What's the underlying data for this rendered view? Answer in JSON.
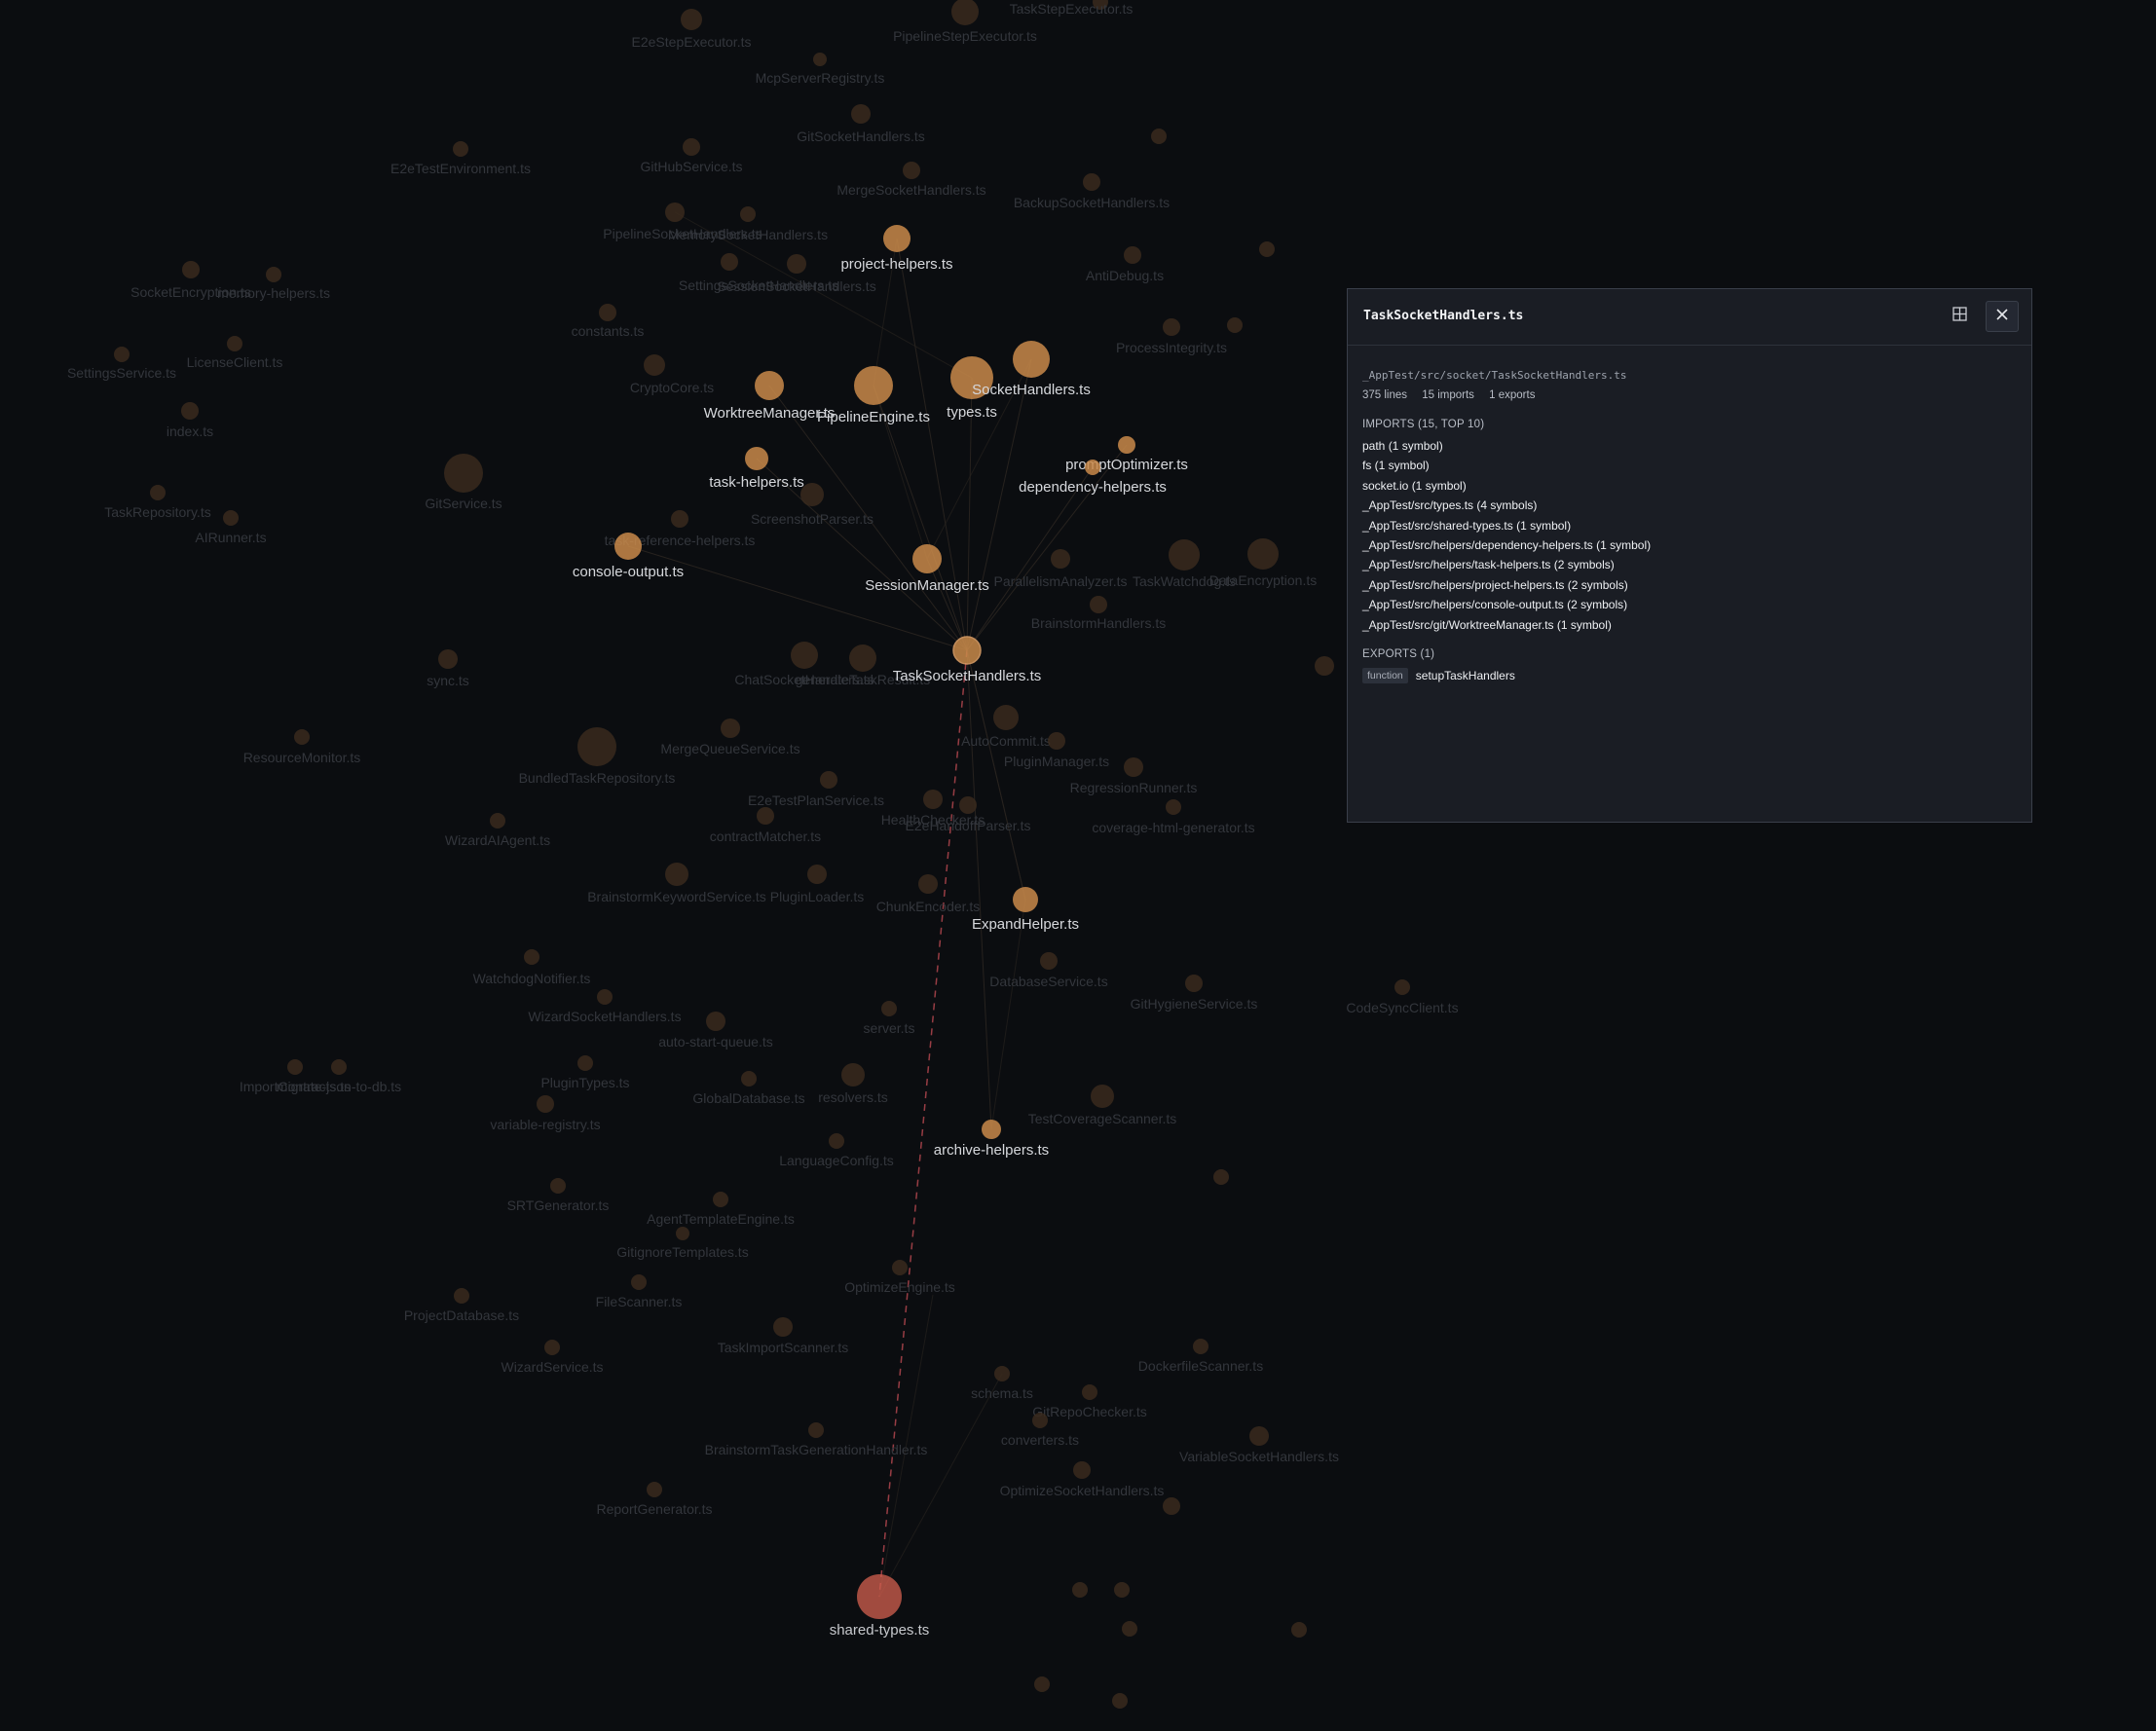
{
  "panel": {
    "title": "TaskSocketHandlers.ts",
    "path": "_AppTest/src/socket/TaskSocketHandlers.ts",
    "lines": "375 lines",
    "imports_count": "15 imports",
    "exports_count": "1 exports",
    "imports_heading": "IMPORTS (15, TOP 10)",
    "imports": [
      "path (1 symbol)",
      "fs (1 symbol)",
      "socket.io (1 symbol)",
      "_AppTest/src/types.ts (4 symbols)",
      "_AppTest/src/shared-types.ts (1 symbol)",
      "_AppTest/src/helpers/dependency-helpers.ts (1 symbol)",
      "_AppTest/src/helpers/task-helpers.ts (2 symbols)",
      "_AppTest/src/helpers/project-helpers.ts (2 symbols)",
      "_AppTest/src/helpers/console-output.ts (2 symbols)",
      "_AppTest/src/git/WorktreeManager.ts (1 symbol)"
    ],
    "exports_heading": "EXPORTS (1)",
    "exports": [
      {
        "kind": "function",
        "name": "setupTaskHandlers"
      }
    ],
    "expand_icon": "grid-expand-icon",
    "close_icon": "close-icon"
  },
  "colors": {
    "background": "#0b0d10",
    "active_node": "#c98a4a",
    "selected_node": "#d4604f",
    "dim_node": "#3a2a1d",
    "label_active": "#d6d8dc",
    "label_dim": "#33363c",
    "edge_dashed": "#a8434a"
  },
  "graph": {
    "active_nodes": [
      {
        "id": "TaskSocketHandlers.ts",
        "label": "TaskSocketHandlers.ts"
      },
      {
        "id": "project-helpers.ts",
        "label": "project-helpers.ts"
      },
      {
        "id": "WorktreeManager.ts",
        "label": "WorktreeManager.ts"
      },
      {
        "id": "PipelineEngine.ts",
        "label": "PipelineEngine.ts"
      },
      {
        "id": "types.ts",
        "label": "types.ts"
      },
      {
        "id": "SocketHandlers.ts",
        "label": "SocketHandlers.ts"
      },
      {
        "id": "promptOptimizer.ts",
        "label": "promptOptimizer.ts"
      },
      {
        "id": "dependency-helpers.ts",
        "label": "dependency-helpers.ts"
      },
      {
        "id": "task-helpers.ts",
        "label": "task-helpers.ts"
      },
      {
        "id": "console-output.ts",
        "label": "console-output.ts"
      },
      {
        "id": "SessionManager.ts",
        "label": "SessionManager.ts"
      },
      {
        "id": "ExpandHelper.ts",
        "label": "ExpandHelper.ts"
      },
      {
        "id": "archive-helpers.ts",
        "label": "archive-helpers.ts"
      },
      {
        "id": "shared-types.ts",
        "label": "shared-types.ts"
      }
    ],
    "dim_nodes": [
      "E2eStepExecutor.ts",
      "PipelineStepExecutor.ts",
      "TaskStepExecutor.ts",
      "McpServerRegistry.ts",
      "GitSocketHandlers.ts",
      "E2eTestEnvironment.ts",
      "GitHubService.ts",
      "MergeSocketHandlers.ts",
      "BackupSocketHandlers.ts",
      "PipelineSocketHandlers.ts",
      "MemorySocketHandlers.ts",
      "SettingsSocketHandlers.ts",
      "SessionSocketHandlers.ts",
      "AntiDebug.ts",
      "ProcessIntegrity.ts",
      "SocketEncryption.ts",
      "memory-helpers.ts",
      "SettingsService.ts",
      "LicenseClient.ts",
      "constants.ts",
      "CryptoCore.ts",
      "index.ts",
      "GitService.ts",
      "TaskRepository.ts",
      "AIRunner.ts",
      "ScreenshotParser.ts",
      "task-reference-helpers.ts",
      "TaskWatchdog.ts",
      "DataEncryption.ts",
      "BrainstormHandlers.ts",
      "ParallelismAnalyzer.ts",
      "ChatSocketHandlers.ts",
      "generateTaskResult.ts",
      "sync.ts",
      "ResourceMonitor.ts",
      "AutoCommit.ts",
      "PluginManager.ts",
      "RegressionRunner.ts",
      "MergeQueueService.ts",
      "BundledTaskRepository.ts",
      "E2eTestPlanService.ts",
      "contractMatcher.ts",
      "HealthChecker.ts",
      "E2eHandoffParser.ts",
      "WizardAIAgent.ts",
      "coverage-html-generator.ts",
      "BrainstormKeywordService.ts",
      "PluginLoader.ts",
      "ChunkEncoder.ts",
      "WatchdogNotifier.ts",
      "DatabaseService.ts",
      "WizardSocketHandlers.ts",
      "server.ts",
      "GitHygieneService.ts",
      "CodeSyncClient.ts",
      "auto-start-queue.ts",
      "ImportContracts.ts",
      "migrate-json-to-db.ts",
      "PluginTypes.ts",
      "variable-registry.ts",
      "GlobalDatabase.ts",
      "resolvers.ts",
      "TestCoverageScanner.ts",
      "LanguageConfig.ts",
      "SRTGenerator.ts",
      "AgentTemplateEngine.ts",
      "GitignoreTemplates.ts",
      "OptimizeEngine.ts",
      "ProjectDatabase.ts",
      "FileScanner.ts",
      "WizardService.ts",
      "TaskImportScanner.ts",
      "DockerfileScanner.ts",
      "schema.ts",
      "GitRepoChecker.ts",
      "converters.ts",
      "BrainstormTaskGenerationHandler.ts",
      "VariableSocketHandlers.ts",
      "OptimizeSocketHandlers.ts",
      "ReportGenerator.ts"
    ]
  }
}
